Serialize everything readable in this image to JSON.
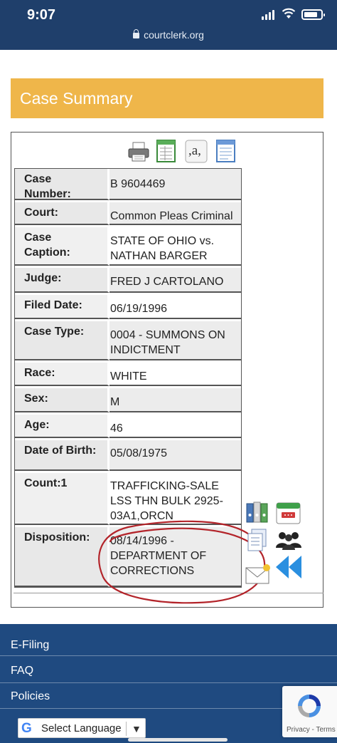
{
  "status_bar": {
    "time": "9:07"
  },
  "browser": {
    "url": "courtclerk.org"
  },
  "header": {
    "title": "Case Summary"
  },
  "toolbar": {
    "icons": [
      "printer-icon",
      "spreadsheet-icon",
      "text-icon",
      "document-icon"
    ],
    "text_icon_glyph": ",a,"
  },
  "case": {
    "rows": [
      {
        "label": "Case Number:",
        "value": "B 9604469"
      },
      {
        "label": "Court:",
        "value": "Common Pleas Criminal"
      },
      {
        "label": "Case Caption:",
        "value": "STATE OF OHIO vs. NATHAN BARGER"
      },
      {
        "label": "Judge:",
        "value": "FRED J CARTOLANO"
      },
      {
        "label": "Filed Date:",
        "value": "06/19/1996"
      },
      {
        "label": "Case Type:",
        "value": "0004 - SUMMONS ON INDICTMENT"
      },
      {
        "label": "Race:",
        "value": "WHITE"
      },
      {
        "label": "Sex:",
        "value": "M"
      },
      {
        "label": "Age:",
        "value": "46"
      },
      {
        "label": "Date of Birth:",
        "value": "05/08/1975"
      },
      {
        "label": "Count:1",
        "value": "TRAFFICKING-SALE LSS THN BULK 2925-03A1,ORCN"
      },
      {
        "label": "Disposition:",
        "value": "08/14/1996 - DEPARTMENT OF CORRECTIONS"
      }
    ]
  },
  "side_icons": [
    "binders-icon",
    "calendar-icon",
    "documents-icon",
    "people-icon",
    "email-icon",
    "rewind-icon"
  ],
  "footer": {
    "items": [
      "E-Filing",
      "FAQ",
      "Policies"
    ],
    "language_label": "Select Language",
    "recaptcha_terms": "Privacy - Terms"
  },
  "colors": {
    "header": "#efb64a",
    "footer": "#1f4a80",
    "topbar": "#1f3f6b",
    "annotation": "#b3242a"
  }
}
